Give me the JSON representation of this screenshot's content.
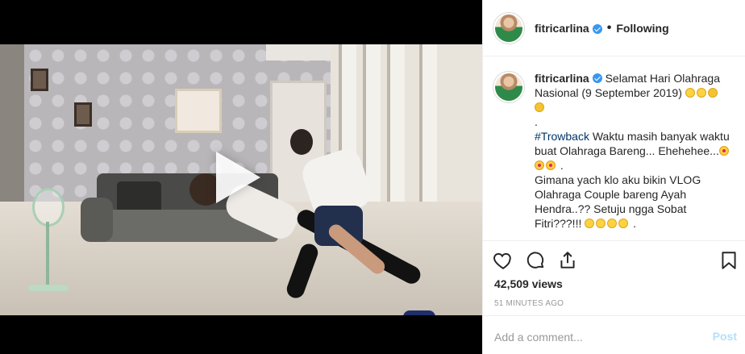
{
  "post": {
    "username": "fitricarlina",
    "separator": "•",
    "follow_status": "Following",
    "caption": {
      "line1": "Selamat Hari Olahraga Nasional (9 September 2019)",
      "dot1": ".",
      "dot2": ".",
      "hashtag": "#Trowback",
      "line2": " Waktu masih banyak waktu buat Olahraga Bareng... Ehehehee...",
      "line3": " .",
      "line4": "Gimana yach klo aku bikin VLOG Olahraga Couple bareng Ayah Hendra..?? Setuju ngga Sobat Fitri???!!!",
      "line4_end": " ."
    },
    "views": "42,509 views",
    "timestamp": "51 MINUTES AGO",
    "comment": {
      "placeholder": "Add a comment...",
      "post_label": "Post"
    }
  },
  "icons": {
    "verified": "verified-badge-icon",
    "play": "play-icon",
    "like": "heart-icon",
    "comment": "comment-bubble-icon",
    "share": "share-icon",
    "save": "bookmark-icon"
  },
  "colors": {
    "verified": "#3897f0",
    "post_button": "#b2dffc",
    "hashtag": "#003569",
    "meta_gray": "#999999"
  }
}
